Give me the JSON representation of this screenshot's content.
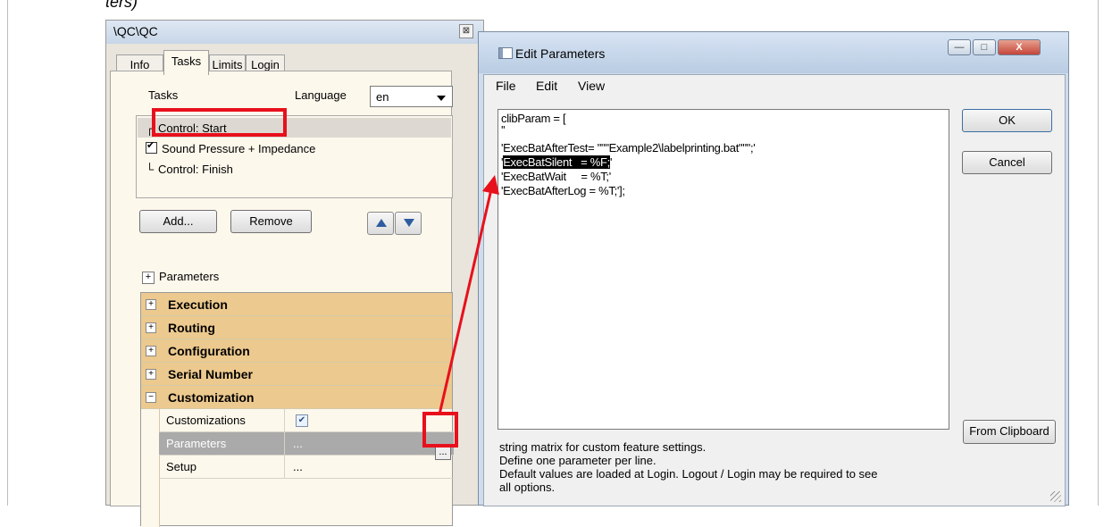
{
  "document": {
    "caption": "ters)"
  },
  "qc_window": {
    "title": "\\QC\\QC",
    "tabs": [
      {
        "label": "Info"
      },
      {
        "label": "Tasks"
      },
      {
        "label": "Limits"
      },
      {
        "label": "Login"
      }
    ],
    "active_tab": "Tasks",
    "tasks_label": "Tasks",
    "language_label": "Language",
    "language_value": "en",
    "task_list": [
      {
        "label": "Control: Start",
        "checked": null,
        "selected": true
      },
      {
        "label": "Sound Pressure + Impedance",
        "checked": true,
        "selected": false
      },
      {
        "label": "Control: Finish",
        "checked": null,
        "selected": false
      }
    ],
    "add_button": "Add...",
    "remove_button": "Remove",
    "parameters_label": "Parameters",
    "parameters_toggle": "+",
    "categories": [
      {
        "label": "Execution",
        "toggle": "+"
      },
      {
        "label": "Routing",
        "toggle": "+"
      },
      {
        "label": "Configuration",
        "toggle": "+"
      },
      {
        "label": "Serial Number",
        "toggle": "+"
      },
      {
        "label": "Customization",
        "toggle": "−"
      }
    ],
    "properties": [
      {
        "name": "Customizations",
        "value": "",
        "checked": true
      },
      {
        "name": "Parameters",
        "value": "...",
        "selected": true
      },
      {
        "name": "Setup",
        "value": "..."
      }
    ],
    "ellipsis_button": "..."
  },
  "edit_window": {
    "title": "Edit Parameters",
    "menu": [
      "File",
      "Edit",
      "View"
    ],
    "code_lines": [
      "clibParam = [",
      "''",
      "'ExecBatAfterTest= \"\"\"Example2\\labelprinting.bat\"\"\";'",
      "'ExecBatSilent   = %F;'",
      "'ExecBatWait     = %T;'",
      "'ExecBatAfterLog = %T;'];"
    ],
    "highlighted_line_text": "ExecBatSilent   = %F;",
    "ok_button": "OK",
    "cancel_button": "Cancel",
    "clipboard_button": "From Clipboard",
    "status_lines": [
      "string matrix for custom feature settings.",
      "Define one parameter per line.",
      "Default values are loaded at Login. Logout / Login may be required to see",
      "all options."
    ],
    "minimize_glyph": "—",
    "maximize_glyph": "□",
    "close_glyph": "X"
  },
  "annotation_color": "#e8101c"
}
